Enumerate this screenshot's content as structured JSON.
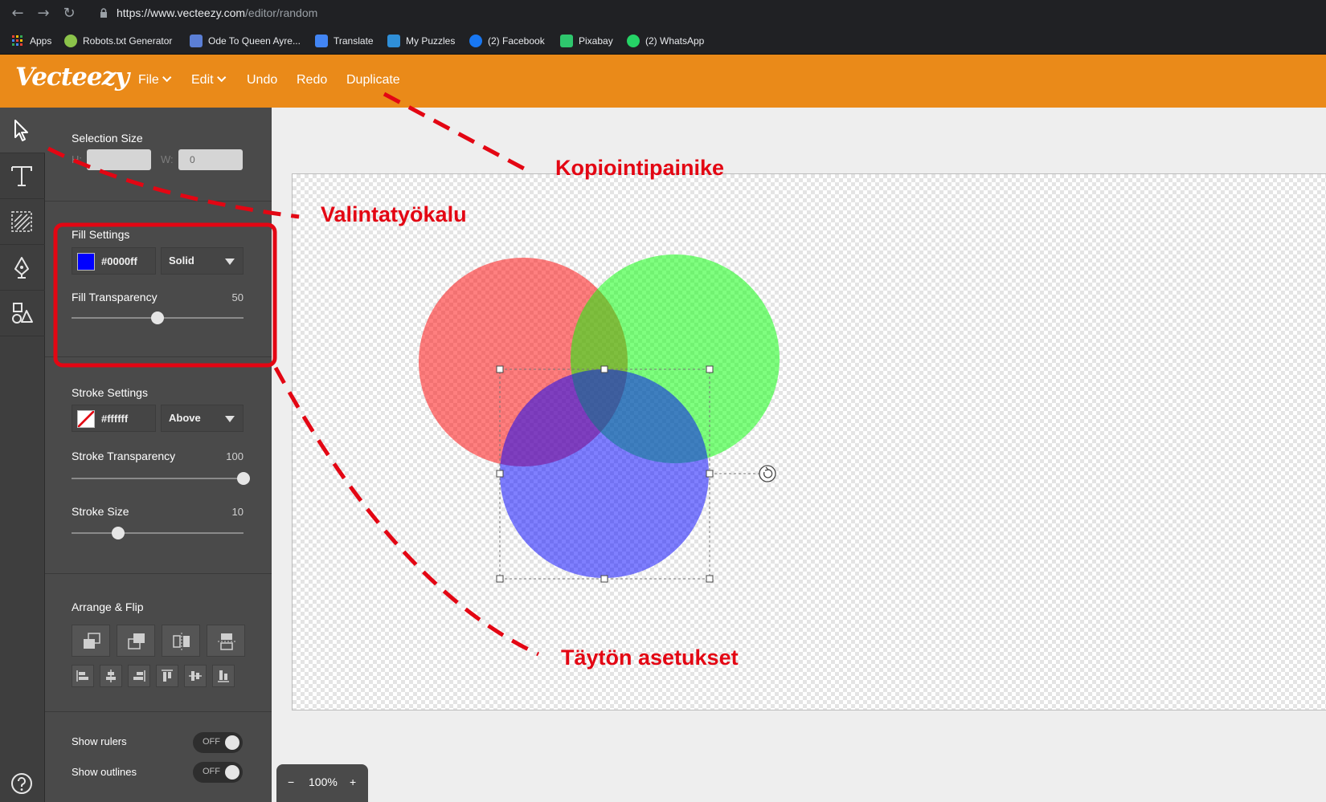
{
  "browser": {
    "url_host": "https://www.vecteezy.com",
    "url_path": "/editor/random",
    "bookmarks": [
      {
        "label": "Apps",
        "icon": "apps-grid-icon",
        "color": "#e94235"
      },
      {
        "label": "Robots.txt Generator",
        "icon": "robot-icon",
        "color": "#8bc34a"
      },
      {
        "label": "Ode To Queen Ayre...",
        "icon": "bookmark-page-icon",
        "color": "#5b7fd6"
      },
      {
        "label": "Translate",
        "icon": "translate-icon",
        "color": "#4285f4"
      },
      {
        "label": "My Puzzles",
        "icon": "puzzle-icon",
        "color": "#2f8fd8"
      },
      {
        "label": "(2) Facebook",
        "icon": "facebook-icon",
        "color": "#1877f2"
      },
      {
        "label": "Pixabay",
        "icon": "pixabay-icon",
        "color": "#2ec66d"
      },
      {
        "label": "(2) WhatsApp",
        "icon": "whatsapp-icon",
        "color": "#25d366"
      }
    ]
  },
  "app": {
    "logo": "Vecteezy",
    "brand_color": "#ea8a19",
    "menu": {
      "file": "File",
      "edit": "Edit",
      "undo": "Undo",
      "redo": "Redo",
      "duplicate": "Duplicate"
    }
  },
  "tools": [
    "select-tool-icon",
    "text-tool-icon",
    "pattern-tool-icon",
    "pen-tool-icon",
    "shapes-tool-icon"
  ],
  "panel": {
    "selection": {
      "title": "Selection Size",
      "h_label": "H:",
      "w_label": "W:",
      "h_value": "",
      "w_value": "0"
    },
    "fill": {
      "title": "Fill Settings",
      "color": "#0000ff",
      "color_text": "#0000ff",
      "type": "Solid",
      "transparency_label": "Fill Transparency",
      "transparency": "50",
      "transparency_frac": 0.5
    },
    "stroke": {
      "title": "Stroke Settings",
      "color_text": "#ffffff",
      "position": "Above",
      "transparency_label": "Stroke Transparency",
      "transparency": "100",
      "transparency_frac": 1.0,
      "size_label": "Stroke Size",
      "size": "10",
      "size_frac": 0.27
    },
    "arrange": {
      "title": "Arrange & Flip"
    },
    "toggles": {
      "rulers_label": "Show rulers",
      "rulers_state": "OFF",
      "outlines_label": "Show outlines",
      "outlines_state": "OFF"
    }
  },
  "zoom": {
    "minus": "−",
    "level": "100%",
    "plus": "+"
  },
  "canvas": {
    "circles": [
      {
        "name": "red-circle",
        "color": "#ff0000",
        "opacity": 0.5
      },
      {
        "name": "green-circle",
        "color": "#00ff00",
        "opacity": 0.5
      },
      {
        "name": "blue-circle",
        "color": "#0000ff",
        "opacity": 0.5
      }
    ]
  },
  "annotations": {
    "duplicate_label": "Kopiointipainike",
    "select_label": "Valintatyökalu",
    "fill_label": "Täytön asetukset",
    "color": "#e30613"
  }
}
